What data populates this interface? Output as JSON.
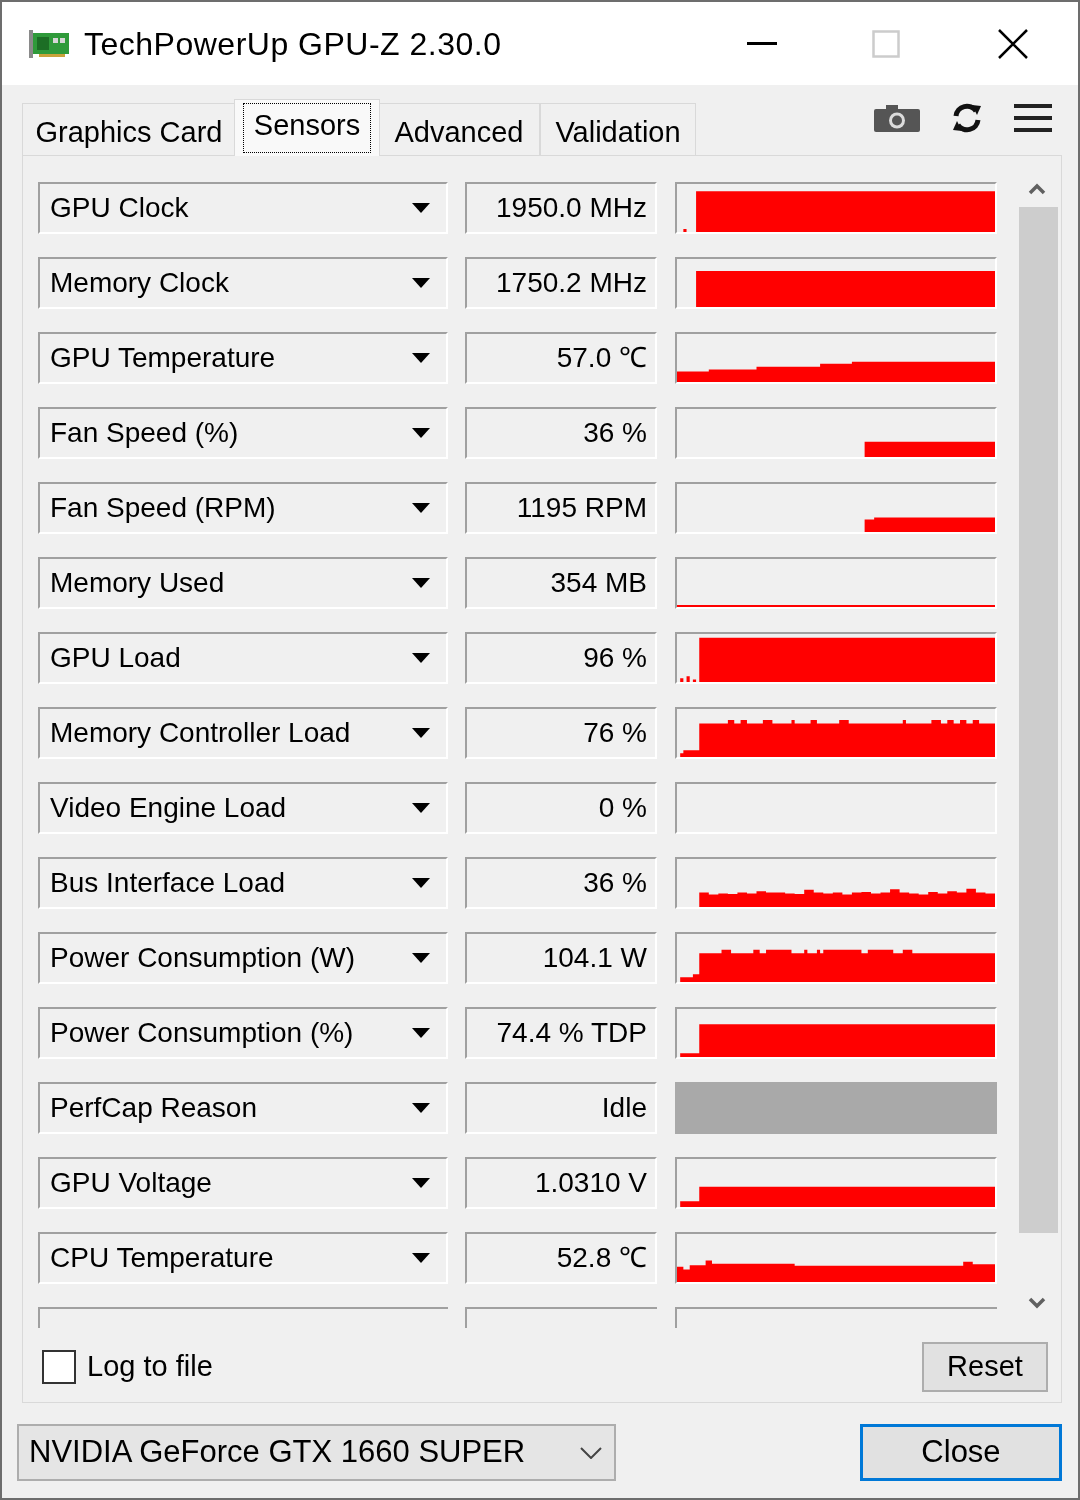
{
  "window": {
    "title": "TechPowerUp GPU-Z 2.30.0",
    "maximize_disabled": true
  },
  "tabs": [
    {
      "label": "Graphics Card",
      "selected": false
    },
    {
      "label": "Sensors",
      "selected": true
    },
    {
      "label": "Advanced",
      "selected": false
    },
    {
      "label": "Validation",
      "selected": false
    }
  ],
  "sensors": [
    {
      "kind": "graph",
      "name": "GPU Clock",
      "value": "1950.0 MHz"
    },
    {
      "kind": "graph",
      "name": "Memory Clock",
      "value": "1750.2 MHz"
    },
    {
      "kind": "graph",
      "name": "GPU Temperature",
      "value": "57.0 ℃"
    },
    {
      "kind": "graph",
      "name": "Fan Speed (%)",
      "value": "36 %"
    },
    {
      "kind": "graph",
      "name": "Fan Speed (RPM)",
      "value": "1195 RPM"
    },
    {
      "kind": "graph",
      "name": "Memory Used",
      "value": "354 MB"
    },
    {
      "kind": "graph",
      "name": "GPU Load",
      "value": "96 %"
    },
    {
      "kind": "graph",
      "name": "Memory Controller Load",
      "value": "76 %"
    },
    {
      "kind": "graph",
      "name": "Video Engine Load",
      "value": "0 %"
    },
    {
      "kind": "graph",
      "name": "Bus Interface Load",
      "value": "36 %"
    },
    {
      "kind": "graph",
      "name": "Power Consumption (W)",
      "value": "104.1 W"
    },
    {
      "kind": "graph",
      "name": "Power Consumption (%)",
      "value": "74.4 % TDP"
    },
    {
      "kind": "status",
      "name": "PerfCap Reason",
      "value": "Idle"
    },
    {
      "kind": "graph",
      "name": "GPU Voltage",
      "value": "1.0310 V"
    },
    {
      "kind": "graph",
      "name": "CPU Temperature",
      "value": "52.8 ℃"
    },
    {
      "kind": "cut"
    }
  ],
  "log_to_file": {
    "label": "Log to file",
    "checked": false
  },
  "reset_button": {
    "label": "Reset"
  },
  "gpu_select": {
    "value": "NVIDIA GeForce GTX 1660 SUPER"
  },
  "close_button": {
    "label": "Close",
    "focused": true
  }
}
